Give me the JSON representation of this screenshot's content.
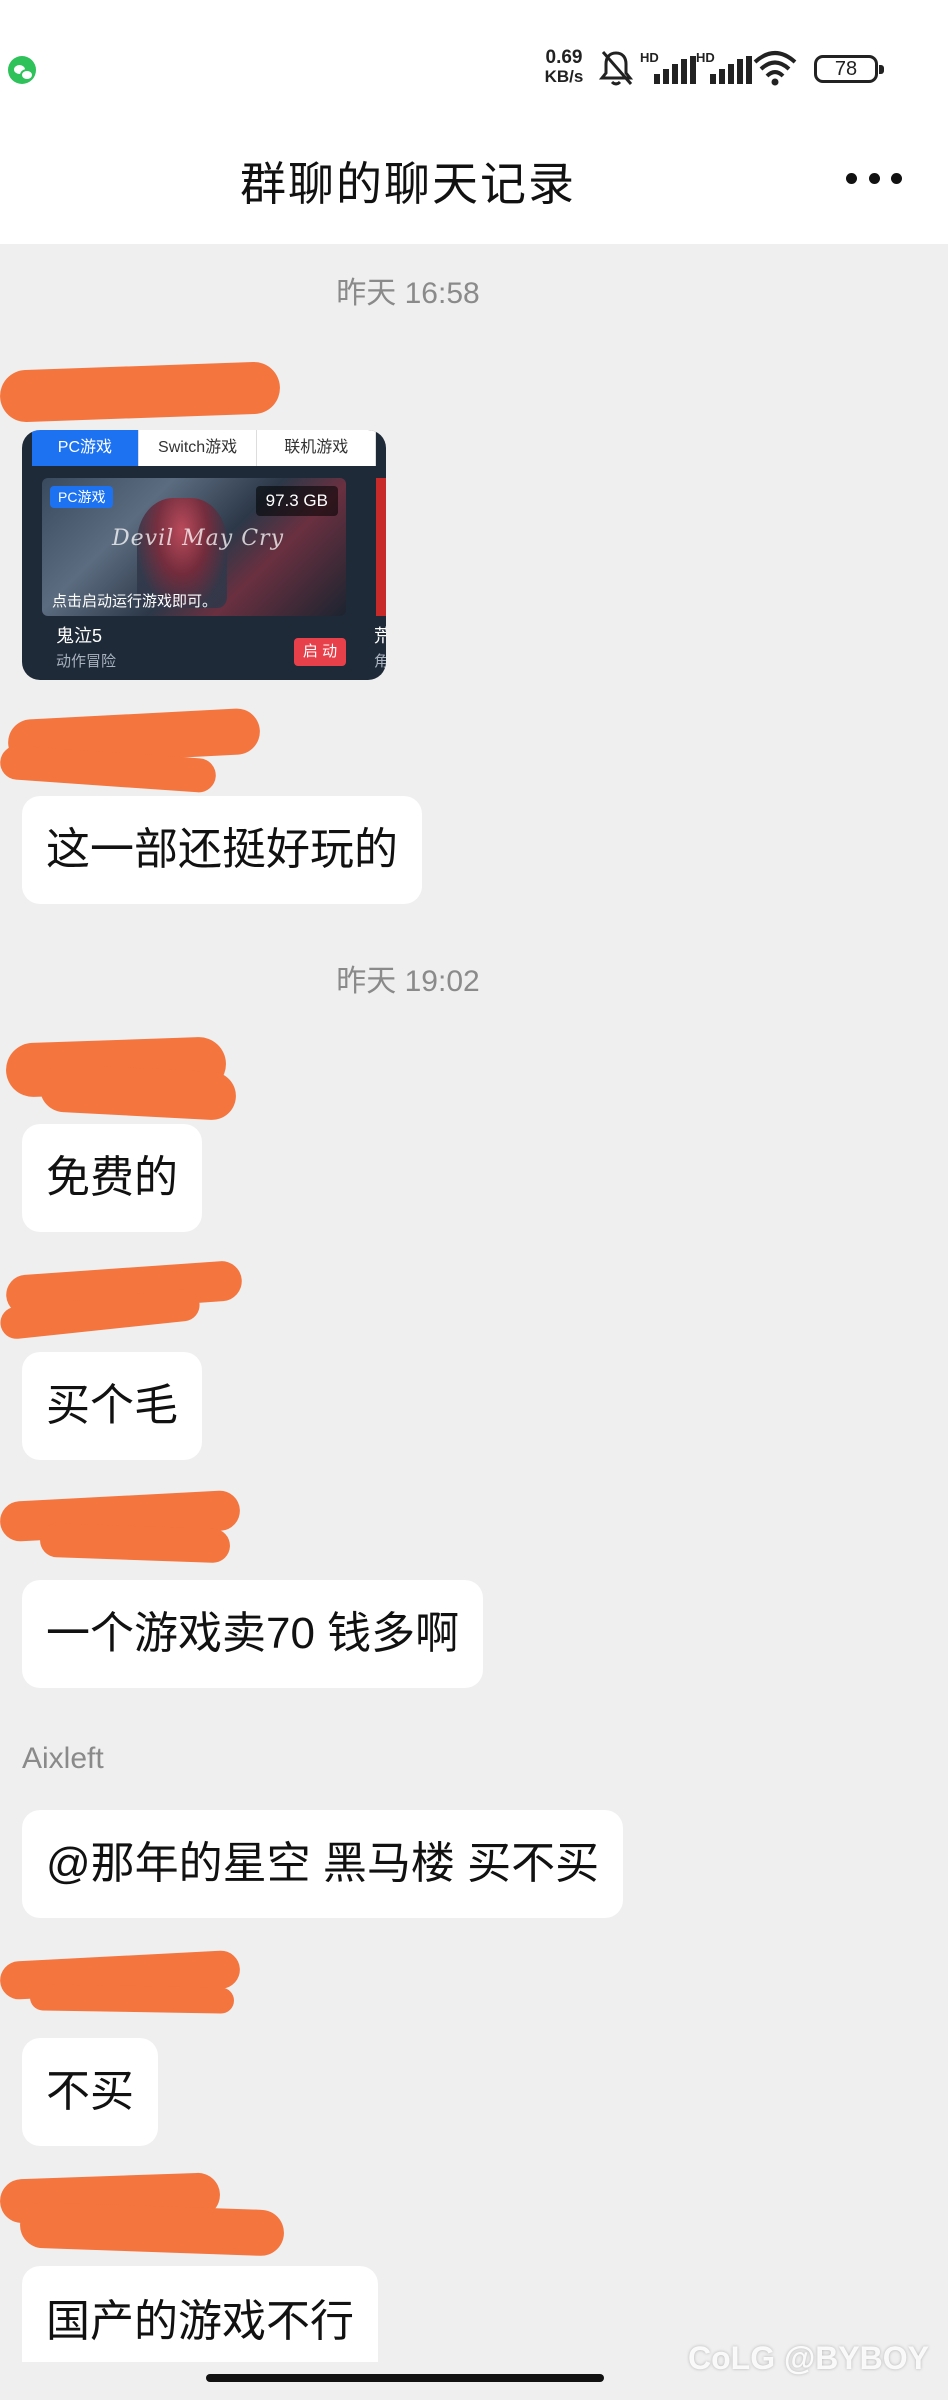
{
  "status_bar": {
    "speed_value": "0.69",
    "speed_unit": "KB/s",
    "signal_1_label": "HD",
    "signal_2_label": "HD",
    "battery_level": "78"
  },
  "header": {
    "title": "群聊的聊天记录",
    "more_icon": "more-icon"
  },
  "messages": {
    "time_1": "昨天 16:58",
    "time_2": "昨天 19:02",
    "game_card": {
      "tab_1": "PC游戏",
      "tab_2": "Switch游戏",
      "tab_3": "联机游戏",
      "badge": "PC游戏",
      "size": "97.3 GB",
      "logo": "Devil May Cry",
      "hint": "点击启动运行游戏即可。",
      "game_name": "鬼泣5",
      "game_category": "动作冒险",
      "start_button": "启 动",
      "next_game_name": "荒",
      "next_game_category": "角"
    },
    "bubble_1": "这一部还挺好玩的",
    "bubble_2": "免费的",
    "bubble_3": "买个毛",
    "bubble_4": "一个游戏卖70 钱多啊",
    "sender_aixleft": "Aixleft",
    "bubble_5": "@那年的星空 黑马楼 买不买",
    "bubble_6": "不买",
    "bubble_7": "国产的游戏不行"
  },
  "watermark": "CoLG @BYBOY",
  "colors": {
    "accent_blue": "#1d72f2",
    "redaction": "#f4753e",
    "start_red": "#e8404a",
    "chat_background": "#efefef"
  }
}
